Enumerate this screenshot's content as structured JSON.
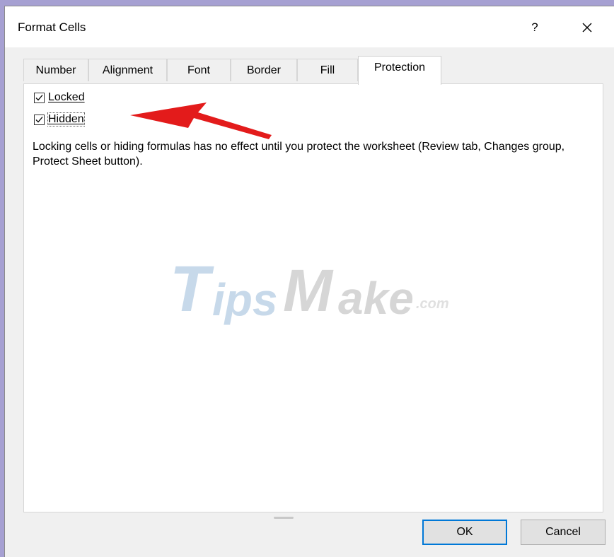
{
  "window": {
    "title": "Format Cells",
    "help_label": "?",
    "close_icon": "close-icon"
  },
  "tabs": [
    {
      "label": "Number",
      "active": false
    },
    {
      "label": "Alignment",
      "active": false
    },
    {
      "label": "Font",
      "active": false
    },
    {
      "label": "Border",
      "active": false
    },
    {
      "label": "Fill",
      "active": false
    },
    {
      "label": "Protection",
      "active": true
    }
  ],
  "protection": {
    "locked": {
      "label": "Locked",
      "checked": true
    },
    "hidden": {
      "label": "Hidden",
      "checked": true
    },
    "description": "Locking cells or hiding formulas has no effect until you protect the worksheet (Review tab, Changes group, Protect Sheet button)."
  },
  "annotation": {
    "arrow_color": "#e31b1b"
  },
  "watermark": {
    "t": "T",
    "ips": "ips",
    "m": "M",
    "ake": "ake",
    "com": ".com"
  },
  "buttons": {
    "ok": "OK",
    "cancel": "Cancel"
  },
  "colors": {
    "ok_border": "#0078d7",
    "titlebar": "#ffffff",
    "dialog_bg": "#f0f0f0"
  }
}
